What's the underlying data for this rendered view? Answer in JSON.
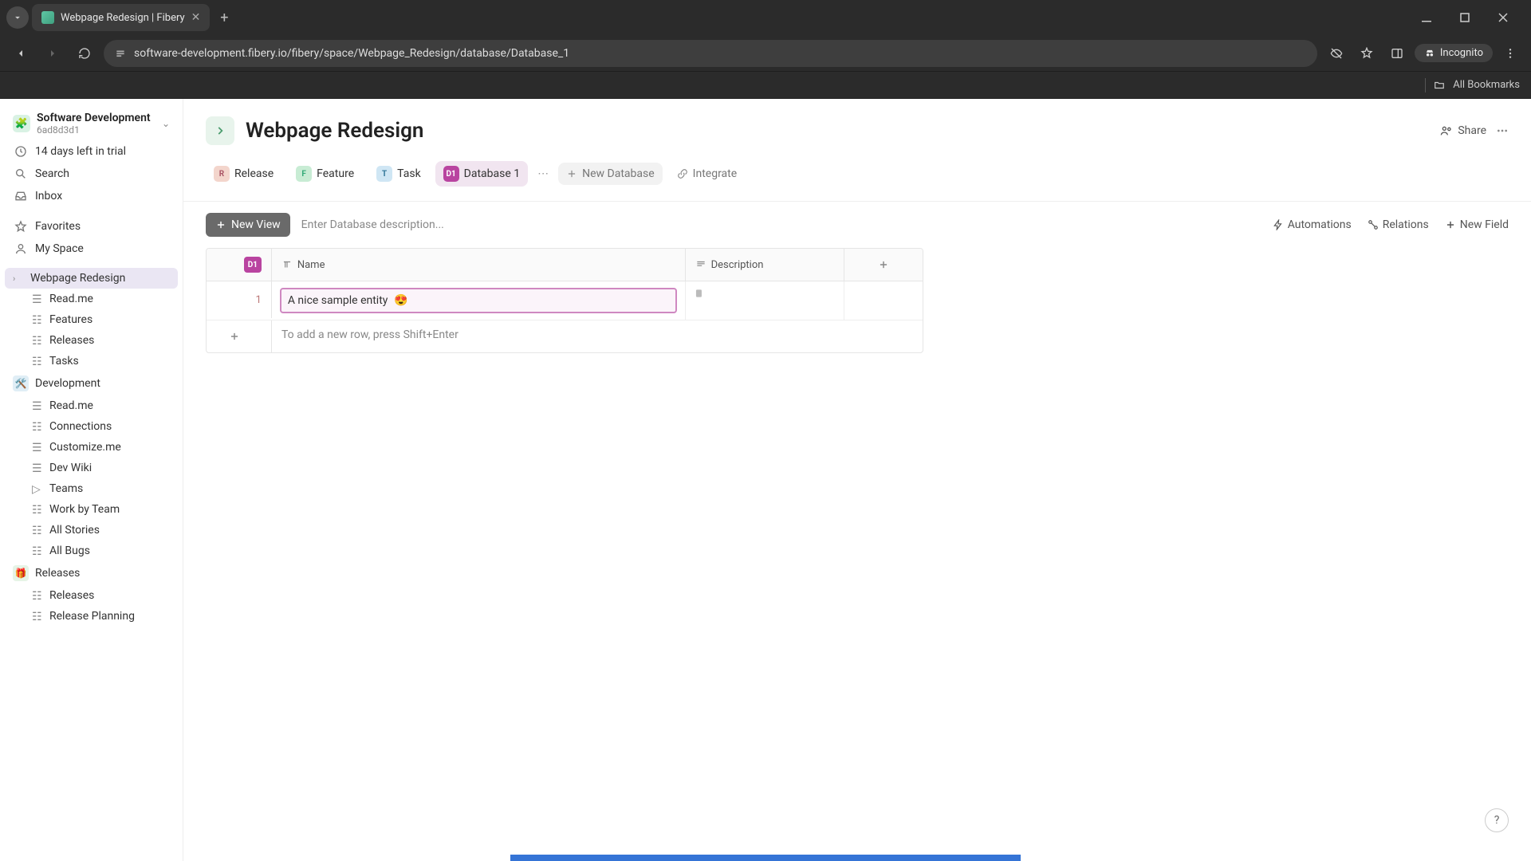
{
  "browser": {
    "tab_title": "Webpage Redesign | Fibery",
    "url": "software-development.fibery.io/fibery/space/Webpage_Redesign/database/Database_1",
    "incognito_label": "Incognito",
    "all_bookmarks": "All Bookmarks"
  },
  "workspace": {
    "name": "Software Development",
    "id": "6ad8d3d1",
    "trial_notice": "14 days left in trial"
  },
  "sidebar": {
    "search": "Search",
    "inbox": "Inbox",
    "favorites": "Favorites",
    "my_space": "My Space",
    "spaces": [
      {
        "name": "Webpage Redesign",
        "active": true,
        "children": [
          "Read.me",
          "Features",
          "Releases",
          "Tasks"
        ]
      },
      {
        "name": "Development",
        "children": [
          "Read.me",
          "Connections",
          "Customize.me",
          "Dev Wiki",
          "Teams",
          "Work by Team",
          "All Stories",
          "All Bugs"
        ]
      },
      {
        "name": "Releases",
        "children": [
          "Releases",
          "Release Planning"
        ]
      }
    ]
  },
  "page": {
    "title": "Webpage Redesign",
    "share_label": "Share"
  },
  "db_tabs": {
    "release": "Release",
    "feature": "Feature",
    "task": "Task",
    "database1": "Database 1",
    "new_database": "New Database",
    "integrate": "Integrate"
  },
  "toolbar": {
    "new_view": "New View",
    "description_placeholder": "Enter Database description...",
    "automations": "Automations",
    "relations": "Relations",
    "new_field": "New Field"
  },
  "table": {
    "badge": "D1",
    "columns": {
      "name": "Name",
      "description": "Description"
    },
    "rows": [
      {
        "num": "1",
        "name": "A nice sample entity",
        "emoji": "😍"
      }
    ],
    "new_row_hint": "To add a new row, press Shift+Enter"
  },
  "help": "?"
}
